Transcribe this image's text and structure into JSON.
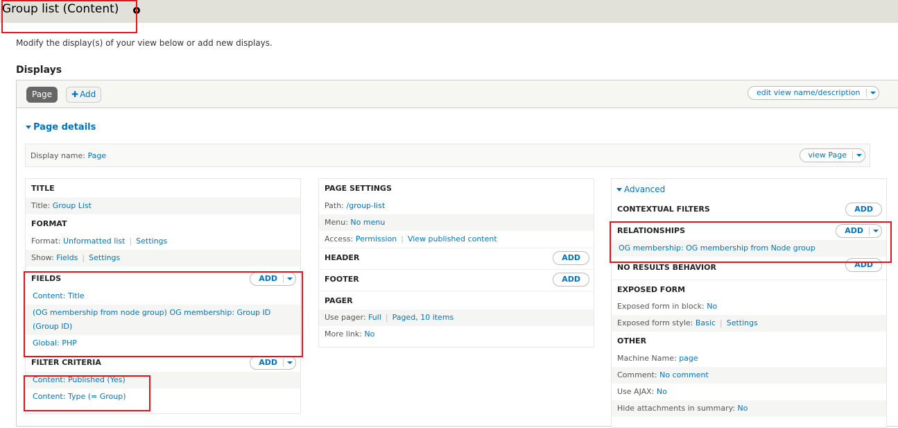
{
  "header": {
    "title": "Group list (Content)",
    "cursor_icon": "move-cursor-icon"
  },
  "intro_text": "Modify the display(s) of your view below or add new displays.",
  "displays": {
    "heading": "Displays",
    "tabs": [
      {
        "label": "Page",
        "active": true
      }
    ],
    "add_label": "Add",
    "add_icon": "plus-icon",
    "edit_view_label": "edit view name/description"
  },
  "page_details": {
    "toggle_label": "Page details",
    "display_name_label": "Display name:",
    "display_name_value": "Page",
    "view_page_label": "view Page"
  },
  "left_column": {
    "title": {
      "heading": "TITLE",
      "label": "Title:",
      "value": "Group List"
    },
    "format": {
      "heading": "FORMAT",
      "format_label": "Format:",
      "format_value": "Unformatted list",
      "format_settings": "Settings",
      "show_label": "Show:",
      "show_value": "Fields",
      "show_settings": "Settings"
    },
    "fields": {
      "heading": "FIELDS",
      "add_label": "Add",
      "items": [
        "Content: Title",
        "(OG membership from node group) OG membership: Group ID (Group ID)",
        "Global: PHP"
      ]
    },
    "filter_criteria": {
      "heading": "FILTER CRITERIA",
      "add_label": "Add",
      "items": [
        "Content: Published (Yes)",
        "Content: Type (= Group)"
      ]
    }
  },
  "middle_column": {
    "page_settings": {
      "heading": "PAGE SETTINGS",
      "path_label": "Path:",
      "path_value": "/group-list",
      "menu_label": "Menu:",
      "menu_value": "No menu",
      "access_label": "Access:",
      "access_value": "Permission",
      "access_detail": "View published content"
    },
    "header_section": {
      "heading": "HEADER",
      "add_label": "Add"
    },
    "footer_section": {
      "heading": "FOOTER",
      "add_label": "Add"
    },
    "pager": {
      "heading": "PAGER",
      "use_pager_label": "Use pager:",
      "use_pager_value": "Full",
      "use_pager_detail": "Paged, 10 items",
      "more_link_label": "More link:",
      "more_link_value": "No"
    }
  },
  "right_column": {
    "advanced_label": "Advanced",
    "contextual_filters": {
      "heading": "CONTEXTUAL FILTERS",
      "add_label": "Add"
    },
    "relationships": {
      "heading": "RELATIONSHIPS",
      "add_label": "Add",
      "items": [
        "OG membership: OG membership from Node group"
      ]
    },
    "no_results": {
      "heading": "NO RESULTS BEHAVIOR",
      "add_label": "Add"
    },
    "exposed_form": {
      "heading": "EXPOSED FORM",
      "in_block_label": "Exposed form in block:",
      "in_block_value": "No",
      "style_label": "Exposed form style:",
      "style_value": "Basic",
      "style_settings": "Settings"
    },
    "other": {
      "heading": "OTHER",
      "machine_name_label": "Machine Name:",
      "machine_name_value": "page",
      "comment_label": "Comment:",
      "comment_value": "No comment",
      "ajax_label": "Use AJAX:",
      "ajax_value": "No",
      "hide_attachments_label": "Hide attachments in summary:",
      "hide_attachments_value": "No"
    }
  },
  "colors": {
    "link": "#0074bd",
    "highlight": "#e0141e",
    "header_bg": "#e1e0d9",
    "active_tab_bg": "#666666"
  }
}
